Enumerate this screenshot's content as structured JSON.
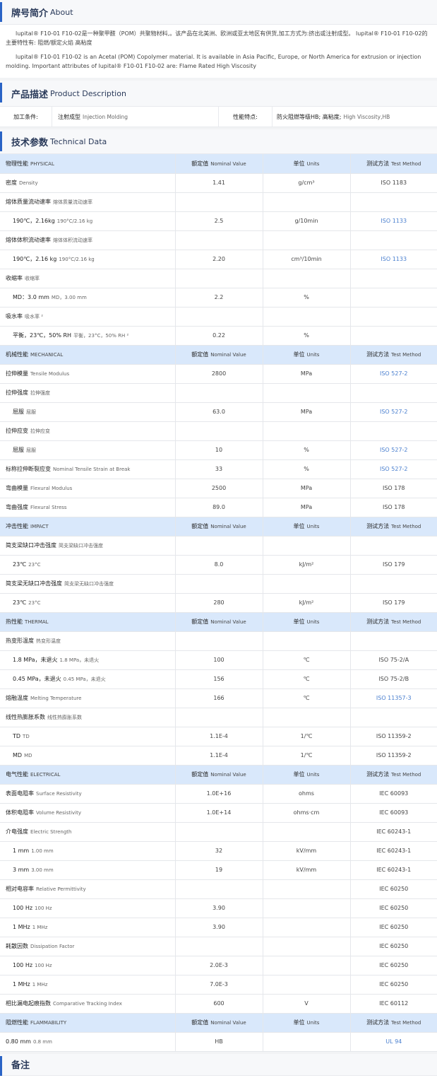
{
  "about": {
    "title_zh": "牌号简介",
    "title_en": "About",
    "text_zh": "lupital® F10-01 F10-02是一种聚甲醛（POM）共聚物材料,。该产品在北美洲、欧洲或亚太地区有供货,加工方式为:挤出或注射成型。 lupital® F10-01 F10-02的主要特性有: 阻燃/额定火焰 高粘度",
    "text_en": "lupital® F10-01 F10-02 is an Acetal (POM) Copolymer material. It is available in Asia Pacific, Europe, or North America for extrusion or injection molding. Important attributes of lupital® F10-01 F10-02 are: Flame Rated High Viscosity"
  },
  "product_desc": {
    "title_zh": "产品描述",
    "title_en": "Product Description",
    "label1": "加工条件:",
    "value1_zh": "注射成型",
    "value1_en": "Injection Molding",
    "label2": "性能特点:",
    "value2_zh": "防火阻燃等级HB; 高粘度;",
    "value2_en": "High Viscosity,HB"
  },
  "tech": {
    "title_zh": "技术参数",
    "title_en": "Technical Data"
  },
  "header_cols": {
    "nominal_zh": "额定值",
    "nominal_en": "Nominal Value",
    "units_zh": "单位",
    "units_en": "Units",
    "method_zh": "测试方法",
    "method_en": "Test Method"
  },
  "rows": [
    {
      "t": "cat",
      "zh": "物理性能",
      "en": "PHYSICAL"
    },
    {
      "t": "prop",
      "zh": "密度",
      "en": "Density",
      "value": "1.41",
      "unit": "g/cm³",
      "method": "ISO 1183",
      "link": false
    },
    {
      "t": "prop",
      "zh": "熔体质量流动速率",
      "en": "熔体质量流动速率",
      "value": "",
      "unit": "",
      "method": "",
      "link": false
    },
    {
      "t": "sub",
      "zh": "190℃，2.16kg",
      "en": "190°C/2.16 kg",
      "value": "2.5",
      "unit": "g/10min",
      "method": "ISO 1133",
      "link": true
    },
    {
      "t": "prop",
      "zh": "熔体体积流动速率",
      "en": "熔体体积流动速率",
      "value": "",
      "unit": "",
      "method": "",
      "link": false
    },
    {
      "t": "sub",
      "zh": "190℃，2.16 kg",
      "en": "190°C/2.16 kg",
      "value": "2.20",
      "unit": "cm³/10min",
      "method": "ISO 1133",
      "link": true
    },
    {
      "t": "prop",
      "zh": "收缩率",
      "en": "收缩率",
      "value": "",
      "unit": "",
      "method": "",
      "link": false
    },
    {
      "t": "sub",
      "zh": "MD：3.0 mm",
      "en": "MD，3.00 mm",
      "value": "2.2",
      "unit": "%",
      "method": "",
      "link": false
    },
    {
      "t": "prop",
      "zh": "吸水率",
      "en": "吸水率 ²",
      "value": "",
      "unit": "",
      "method": "",
      "link": false
    },
    {
      "t": "sub",
      "zh": "平衡，23℃，50% RH",
      "en": "平衡，23°C，50% RH ²",
      "value": "0.22",
      "unit": "%",
      "method": "",
      "link": false
    },
    {
      "t": "cat",
      "zh": "机械性能",
      "en": "MECHANICAL"
    },
    {
      "t": "prop",
      "zh": "拉伸模量",
      "en": "Tensile Modulus",
      "value": "2800",
      "unit": "MPa",
      "method": "ISO 527-2",
      "link": true
    },
    {
      "t": "prop",
      "zh": "拉伸强度",
      "en": "拉伸强度",
      "value": "",
      "unit": "",
      "method": "",
      "link": false
    },
    {
      "t": "sub",
      "zh": "屈服",
      "en": "屈服",
      "value": "63.0",
      "unit": "MPa",
      "method": "ISO 527-2",
      "link": true
    },
    {
      "t": "prop",
      "zh": "拉伸应变",
      "en": "拉伸应变",
      "value": "",
      "unit": "",
      "method": "",
      "link": false
    },
    {
      "t": "sub",
      "zh": "屈服",
      "en": "屈服",
      "value": "10",
      "unit": "%",
      "method": "ISO 527-2",
      "link": true
    },
    {
      "t": "prop",
      "zh": "标称拉伸断裂应变",
      "en": "Nominal Tensile Strain at Break",
      "value": "33",
      "unit": "%",
      "method": "ISO 527-2",
      "link": true
    },
    {
      "t": "prop",
      "zh": "弯曲模量",
      "en": "Flexural Modulus",
      "value": "2500",
      "unit": "MPa",
      "method": "ISO 178",
      "link": false
    },
    {
      "t": "prop",
      "zh": "弯曲强度",
      "en": "Flexural Stress",
      "value": "89.0",
      "unit": "MPa",
      "method": "ISO 178",
      "link": false
    },
    {
      "t": "cat",
      "zh": "冲击性能",
      "en": "IMPACT"
    },
    {
      "t": "prop",
      "zh": "简支梁缺口冲击强度",
      "en": "简支梁缺口冲击强度",
      "value": "",
      "unit": "",
      "method": "",
      "link": false
    },
    {
      "t": "sub",
      "zh": "23℃",
      "en": "23°C",
      "value": "8.0",
      "unit": "kJ/m²",
      "method": "ISO 179",
      "link": false
    },
    {
      "t": "prop",
      "zh": "简支梁无缺口冲击强度",
      "en": "简支梁无缺口冲击强度",
      "value": "",
      "unit": "",
      "method": "",
      "link": false
    },
    {
      "t": "sub",
      "zh": "23℃",
      "en": "23°C",
      "value": "280",
      "unit": "kJ/m²",
      "method": "ISO 179",
      "link": false
    },
    {
      "t": "cat",
      "zh": "热性能",
      "en": "THERMAL"
    },
    {
      "t": "prop",
      "zh": "热变形温度",
      "en": "热变形温度",
      "value": "",
      "unit": "",
      "method": "",
      "link": false
    },
    {
      "t": "sub",
      "zh": "1.8 MPa，未退火",
      "en": "1.8 MPa，未退火",
      "value": "100",
      "unit": "℃",
      "method": "ISO 75-2/A",
      "link": false
    },
    {
      "t": "sub",
      "zh": "0.45 MPa，未退火",
      "en": "0.45 MPa，未退火",
      "value": "156",
      "unit": "℃",
      "method": "ISO 75-2/B",
      "link": false
    },
    {
      "t": "prop",
      "zh": "熔融温度",
      "en": "Melting Temperature",
      "value": "166",
      "unit": "℃",
      "method": "ISO 11357-3",
      "link": true
    },
    {
      "t": "prop",
      "zh": "线性热膨胀系数",
      "en": "线性热膨胀系数",
      "value": "",
      "unit": "",
      "method": "",
      "link": false
    },
    {
      "t": "sub",
      "zh": "TD",
      "en": "TD",
      "value": "1.1E-4",
      "unit": "1/℃",
      "method": "ISO 11359-2",
      "link": false
    },
    {
      "t": "sub",
      "zh": "MD",
      "en": "MD",
      "value": "1.1E-4",
      "unit": "1/℃",
      "method": "ISO 11359-2",
      "link": false
    },
    {
      "t": "cat",
      "zh": "电气性能",
      "en": "ELECTRICAL"
    },
    {
      "t": "prop",
      "zh": "表面电阻率",
      "en": "Surface Resistivity",
      "value": "1.0E+16",
      "unit": "ohms",
      "method": "IEC 60093",
      "link": false
    },
    {
      "t": "prop",
      "zh": "体积电阻率",
      "en": "Volume Resistivity",
      "value": "1.0E+14",
      "unit": "ohms·cm",
      "method": "IEC 60093",
      "link": false
    },
    {
      "t": "prop",
      "zh": "介电强度",
      "en": "Electric Strength",
      "value": "",
      "unit": "",
      "method": "IEC 60243-1",
      "link": false
    },
    {
      "t": "sub",
      "zh": "1 mm",
      "en": "1.00 mm",
      "value": "32",
      "unit": "kV/mm",
      "method": "IEC 60243-1",
      "link": false
    },
    {
      "t": "sub",
      "zh": "3 mm",
      "en": "3.00 mm",
      "value": "19",
      "unit": "kV/mm",
      "method": "IEC 60243-1",
      "link": false
    },
    {
      "t": "prop",
      "zh": "相对电容率",
      "en": "Relative Permittivity",
      "value": "",
      "unit": "",
      "method": "IEC 60250",
      "link": false
    },
    {
      "t": "sub",
      "zh": "100 Hz",
      "en": "100 Hz",
      "value": "3.90",
      "unit": "",
      "method": "IEC 60250",
      "link": false
    },
    {
      "t": "sub",
      "zh": "1 MHz",
      "en": "1 MHz",
      "value": "3.90",
      "unit": "",
      "method": "IEC 60250",
      "link": false
    },
    {
      "t": "prop",
      "zh": "耗散因数",
      "en": "Dissipation Factor",
      "value": "",
      "unit": "",
      "method": "IEC 60250",
      "link": false
    },
    {
      "t": "sub",
      "zh": "100 Hz",
      "en": "100 Hz",
      "value": "2.0E-3",
      "unit": "",
      "method": "IEC 60250",
      "link": false
    },
    {
      "t": "sub",
      "zh": "1 MHz",
      "en": "1 MHz",
      "value": "7.0E-3",
      "unit": "",
      "method": "IEC 60250",
      "link": false
    },
    {
      "t": "prop",
      "zh": "相比漏电起痕指数",
      "en": "Comparative Tracking Index",
      "value": "600",
      "unit": "V",
      "method": "IEC 60112",
      "link": false
    },
    {
      "t": "cat",
      "zh": "阻燃性能",
      "en": "FLAMMABILITY"
    },
    {
      "t": "prop",
      "zh": "0.80 mm",
      "en": "0.8 mm",
      "value": "HB",
      "unit": "",
      "method": "UL 94",
      "link": true
    }
  ],
  "notes": {
    "title_zh": "备注"
  },
  "colors": {
    "accent": "#2b64c6",
    "category_bg": "#d9e8fb",
    "link": "#4a7fcf"
  }
}
